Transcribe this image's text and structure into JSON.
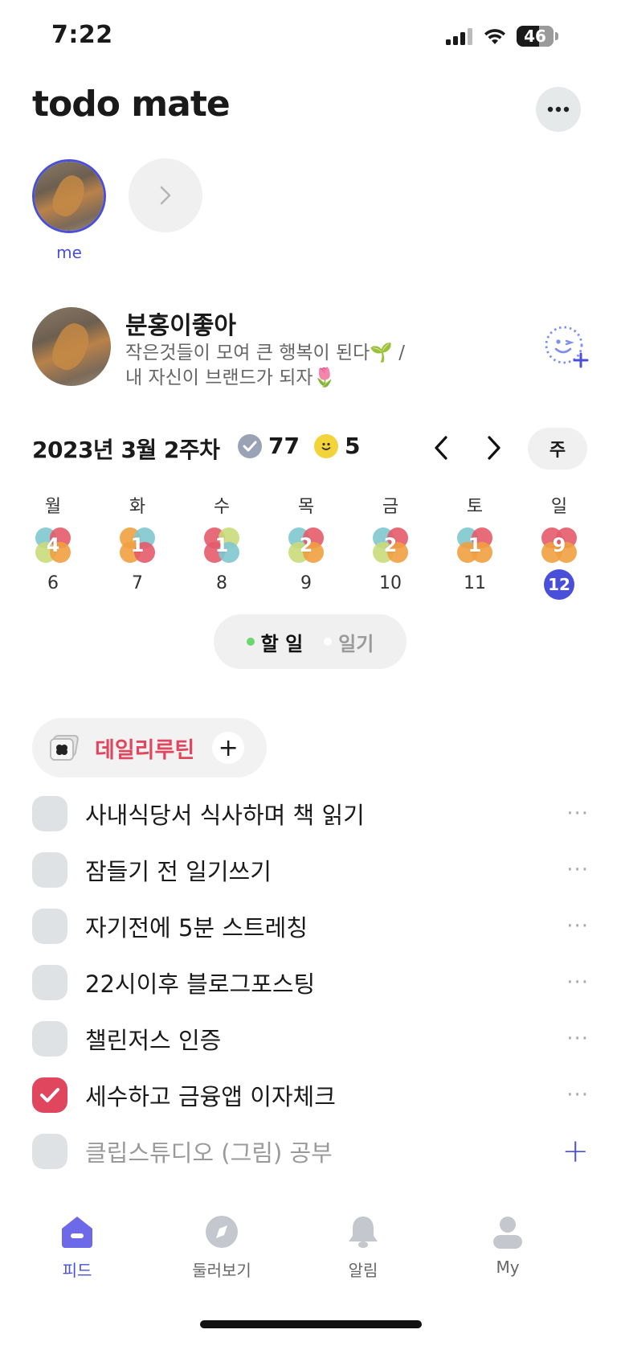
{
  "status": {
    "time": "7:22",
    "battery": "46"
  },
  "app": {
    "title": "todo mate"
  },
  "stories": {
    "me_label": "me"
  },
  "profile": {
    "name": "분홍이좋아",
    "bio": "작은것들이 모여 큰 행복이 된다🌱  /\n내 자신이 브랜드가 되자🌷"
  },
  "week": {
    "title": "2023년 3월 2주차",
    "done_count": "77",
    "emoji_count": "5",
    "view_toggle": "주",
    "days": [
      {
        "name": "월",
        "count": "4",
        "date": "6"
      },
      {
        "name": "화",
        "count": "1",
        "date": "7"
      },
      {
        "name": "수",
        "count": "1",
        "date": "8"
      },
      {
        "name": "목",
        "count": "2",
        "date": "9"
      },
      {
        "name": "금",
        "count": "2",
        "date": "10"
      },
      {
        "name": "토",
        "count": "1",
        "date": "11"
      },
      {
        "name": "일",
        "count": "9",
        "date": "12"
      }
    ],
    "selected_date": "12"
  },
  "mode": {
    "todo_label": "할 일",
    "diary_label": "일기"
  },
  "routine": {
    "label": "데일리루틴",
    "add": "+"
  },
  "todos": [
    {
      "text": "사내식당서 식사하며 책  읽기",
      "done": false
    },
    {
      "text": "잠들기 전 일기쓰기",
      "done": false
    },
    {
      "text": "자기전에 5분 스트레칭",
      "done": false
    },
    {
      "text": "22시이후 블로그포스팅",
      "done": false
    },
    {
      "text": "챌린저스 인증",
      "done": false
    },
    {
      "text": "세수하고 금융앱 이자체크",
      "done": true
    },
    {
      "text": "클립스튜디오 (그림) 공부",
      "done": false,
      "pending": true
    }
  ],
  "tabs": {
    "feed": "피드",
    "explore": "둘러보기",
    "notifications": "알림",
    "my": "My"
  },
  "colors": {
    "accent": "#4a4fd9",
    "routine": "#e0475f",
    "clover_red": "#e45b6a",
    "clover_orange": "#f1a040",
    "clover_green": "#c9dc7a",
    "clover_teal": "#7fc8cf"
  }
}
